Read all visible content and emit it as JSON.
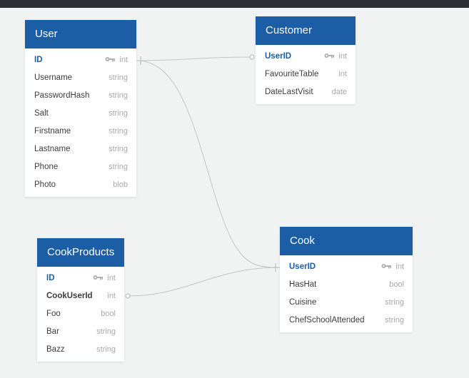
{
  "tables": {
    "user": {
      "title": "User",
      "fields": [
        {
          "name": "ID",
          "type": "int"
        },
        {
          "name": "Username",
          "type": "string"
        },
        {
          "name": "PasswordHash",
          "type": "string"
        },
        {
          "name": "Salt",
          "type": "string"
        },
        {
          "name": "Firstname",
          "type": "string"
        },
        {
          "name": "Lastname",
          "type": "string"
        },
        {
          "name": "Phone",
          "type": "string"
        },
        {
          "name": "Photo",
          "type": "blob"
        }
      ]
    },
    "customer": {
      "title": "Customer",
      "fields": [
        {
          "name": "UserID",
          "type": "int"
        },
        {
          "name": "FavouriteTable",
          "type": "int"
        },
        {
          "name": "DateLastVisit",
          "type": "date"
        }
      ]
    },
    "cookproducts": {
      "title": "CookProducts",
      "fields": [
        {
          "name": "ID",
          "type": "int"
        },
        {
          "name": "CookUserId",
          "type": "int"
        },
        {
          "name": "Foo",
          "type": "bool"
        },
        {
          "name": "Bar",
          "type": "string"
        },
        {
          "name": "Bazz",
          "type": "string"
        }
      ]
    },
    "cook": {
      "title": "Cook",
      "fields": [
        {
          "name": "UserID",
          "type": "int"
        },
        {
          "name": "HasHat",
          "type": "bool"
        },
        {
          "name": "Cuisine",
          "type": "string"
        },
        {
          "name": "ChefSchoolAttended",
          "type": "string"
        }
      ]
    }
  },
  "colors": {
    "header": "#1b5ea6",
    "primary_key_text": "#1b5ea6",
    "type_text": "#a9a9a9",
    "relation_line": "#c4c4c4",
    "background": "#f1f3f2"
  },
  "icons": {
    "primary_key": "key-icon"
  },
  "relations": [
    {
      "from": "User.ID",
      "to": "Customer.UserID"
    },
    {
      "from": "User.ID",
      "to": "Cook.UserID"
    },
    {
      "from": "CookProducts.CookUserId",
      "to": "Cook.UserID"
    }
  ]
}
